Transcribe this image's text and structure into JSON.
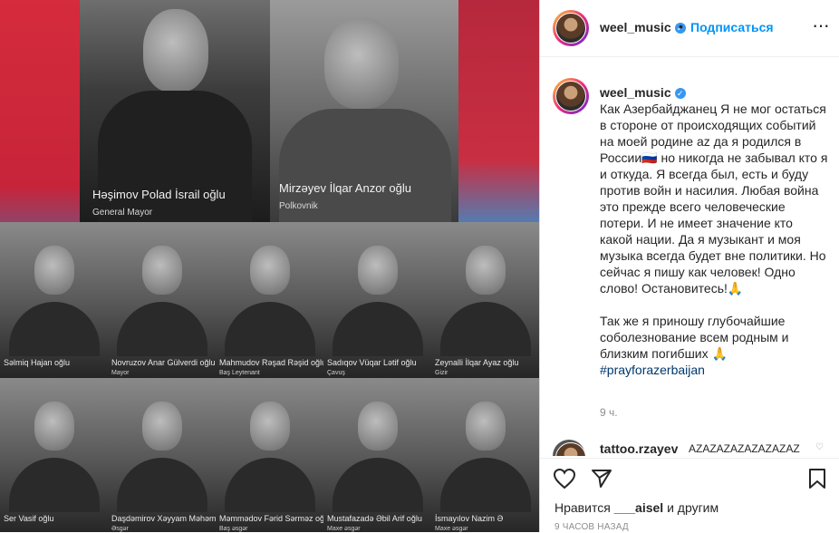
{
  "post_image": {
    "top_portraits": [
      {
        "name": "Həşimov Polad İsrail oğlu",
        "rank": "General Mayor"
      },
      {
        "name": "Mirzəyev İlqar Anzor oğlu",
        "rank": "Polkovnik"
      }
    ],
    "row1": [
      {
        "name": "Səlmiq Hajan oğlu",
        "rank": ""
      },
      {
        "name": "Novruzov Anar Gülverdi oğlu",
        "rank": "Mayor"
      },
      {
        "name": "Mahmudov Rəşad Rəşid oğlu",
        "rank": "Baş Leytenant"
      },
      {
        "name": "Sadıqov Vüqar Lətif oğlu",
        "rank": "Çavuş"
      },
      {
        "name": "Zeynalli İlqar Ayaz oğlu",
        "rank": "Gizir"
      }
    ],
    "row2": [
      {
        "name": "Ser Vasif oğlu",
        "rank": ""
      },
      {
        "name": "Daşdəmirov Xəyyam Məhəmməd oğlu",
        "rank": "Əsgər"
      },
      {
        "name": "Məmmədov Fərid Sərməz oğlu",
        "rank": "Baş əsgər"
      },
      {
        "name": "Mustafazadə Əbil Arif oğlu",
        "rank": "Maxe əsgər"
      },
      {
        "name": "İsmayılov Nazim Ə",
        "rank": "Maxe əsgər"
      }
    ]
  },
  "header": {
    "username": "weel_music",
    "follow_label": "Подписаться",
    "separator": "•",
    "more_label": "···"
  },
  "caption": {
    "username": "weel_music",
    "text1": "Как Азербайджанец Я не мог остаться в стороне от происходящих событий на моей родине az да я родился в России🇷🇺 но никогда не забывал кто я и откуда. Я всегда был, есть и буду против войн и насилия. Любая война это прежде всего человеческие потери. И не имеет значение кто какой нации. Да я музыкант и моя музыка всегда будет вне политики. Но сейчас я пишу как человек! Одно слово! Остановитесь!🙏",
    "text2": "Так же я приношу глубочайшие соболезнование всем родным и близким погибших 🙏",
    "hashtag": "#prayforazerbaijan",
    "time": "9 ч."
  },
  "comment": {
    "username": "tattoo.rzayev",
    "text": "AZAZAZAZAZAZAZAZ"
  },
  "footer": {
    "likes_prefix": "Нравится",
    "likes_user": "___aisel",
    "likes_suffix": "и другим",
    "ago": "9 ЧАСОВ НАЗАД"
  }
}
